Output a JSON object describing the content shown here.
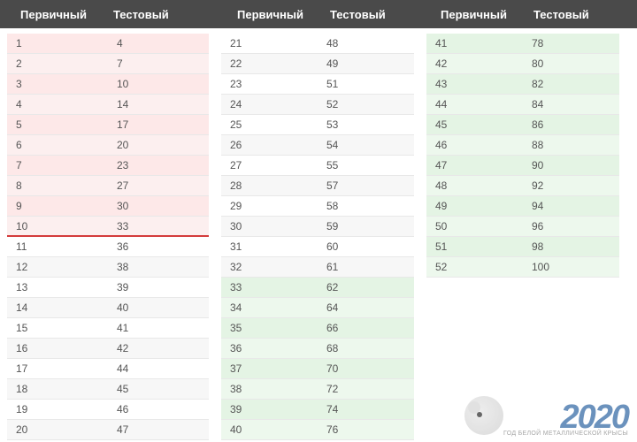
{
  "headers": {
    "primary": "Первичный",
    "test": "Тестовый"
  },
  "columns": [
    {
      "rows": [
        {
          "p": 1,
          "t": 4,
          "style": "pink"
        },
        {
          "p": 2,
          "t": 7,
          "style": "pink"
        },
        {
          "p": 3,
          "t": 10,
          "style": "pink"
        },
        {
          "p": 4,
          "t": 14,
          "style": "pink"
        },
        {
          "p": 5,
          "t": 17,
          "style": "pink"
        },
        {
          "p": 6,
          "t": 20,
          "style": "pink"
        },
        {
          "p": 7,
          "t": 23,
          "style": "pink"
        },
        {
          "p": 8,
          "t": 27,
          "style": "pink"
        },
        {
          "p": 9,
          "t": 30,
          "style": "pink"
        },
        {
          "p": 10,
          "t": 33,
          "style": "pink",
          "redline": true
        },
        {
          "p": 11,
          "t": 36,
          "style": "plain"
        },
        {
          "p": 12,
          "t": 38,
          "style": "plain"
        },
        {
          "p": 13,
          "t": 39,
          "style": "plain"
        },
        {
          "p": 14,
          "t": 40,
          "style": "plain"
        },
        {
          "p": 15,
          "t": 41,
          "style": "plain"
        },
        {
          "p": 16,
          "t": 42,
          "style": "plain"
        },
        {
          "p": 17,
          "t": 44,
          "style": "plain"
        },
        {
          "p": 18,
          "t": 45,
          "style": "plain"
        },
        {
          "p": 19,
          "t": 46,
          "style": "plain"
        },
        {
          "p": 20,
          "t": 47,
          "style": "plain"
        }
      ]
    },
    {
      "rows": [
        {
          "p": 21,
          "t": 48,
          "style": "plain"
        },
        {
          "p": 22,
          "t": 49,
          "style": "plain"
        },
        {
          "p": 23,
          "t": 51,
          "style": "plain"
        },
        {
          "p": 24,
          "t": 52,
          "style": "plain"
        },
        {
          "p": 25,
          "t": 53,
          "style": "plain"
        },
        {
          "p": 26,
          "t": 54,
          "style": "plain"
        },
        {
          "p": 27,
          "t": 55,
          "style": "plain"
        },
        {
          "p": 28,
          "t": 57,
          "style": "plain"
        },
        {
          "p": 29,
          "t": 58,
          "style": "plain"
        },
        {
          "p": 30,
          "t": 59,
          "style": "plain"
        },
        {
          "p": 31,
          "t": 60,
          "style": "plain"
        },
        {
          "p": 32,
          "t": 61,
          "style": "plain"
        },
        {
          "p": 33,
          "t": 62,
          "style": "green"
        },
        {
          "p": 34,
          "t": 64,
          "style": "green"
        },
        {
          "p": 35,
          "t": 66,
          "style": "green"
        },
        {
          "p": 36,
          "t": 68,
          "style": "green"
        },
        {
          "p": 37,
          "t": 70,
          "style": "green"
        },
        {
          "p": 38,
          "t": 72,
          "style": "green"
        },
        {
          "p": 39,
          "t": 74,
          "style": "green"
        },
        {
          "p": 40,
          "t": 76,
          "style": "green"
        }
      ]
    },
    {
      "rows": [
        {
          "p": 41,
          "t": 78,
          "style": "green"
        },
        {
          "p": 42,
          "t": 80,
          "style": "green"
        },
        {
          "p": 43,
          "t": 82,
          "style": "green"
        },
        {
          "p": 44,
          "t": 84,
          "style": "green"
        },
        {
          "p": 45,
          "t": 86,
          "style": "green"
        },
        {
          "p": 46,
          "t": 88,
          "style": "green"
        },
        {
          "p": 47,
          "t": 90,
          "style": "green"
        },
        {
          "p": 48,
          "t": 92,
          "style": "green"
        },
        {
          "p": 49,
          "t": 94,
          "style": "green"
        },
        {
          "p": 50,
          "t": 96,
          "style": "green"
        },
        {
          "p": 51,
          "t": 98,
          "style": "green"
        },
        {
          "p": 52,
          "t": 100,
          "style": "green"
        }
      ]
    }
  ],
  "watermark": {
    "year": "2020",
    "sub": "ГОД БЕЛОЙ МЕТАЛЛИЧЕСКОЙ КРЫСЫ"
  }
}
